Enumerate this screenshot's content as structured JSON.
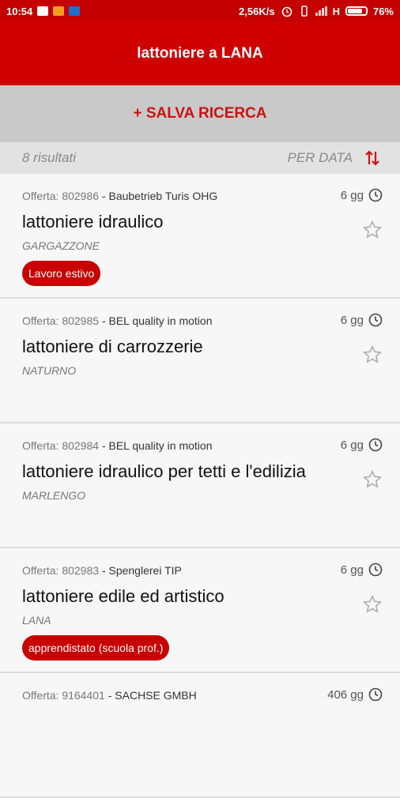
{
  "status": {
    "time": "10:54",
    "speed": "2,56K/s",
    "network": "H",
    "battery": "76%"
  },
  "header": {
    "title": "lattoniere a LANA"
  },
  "save": {
    "label": "+ SALVA RICERCA"
  },
  "sort": {
    "count": "8 risultati",
    "label": "PER DATA",
    "icon": "sort-arrows-icon"
  },
  "offer_prefix": "Offerta:",
  "colors": {
    "primary": "#cf0000",
    "save_text": "#cc1111",
    "tag_bg": "#c80000"
  },
  "jobs": [
    {
      "id": "802986",
      "company": "- Baubetrieb Turis OHG",
      "age": "6 gg",
      "title": "lattoniere idraulico",
      "place": "GARGAZZONE",
      "tag": "Lavoro estivo"
    },
    {
      "id": "802985",
      "company": "- BEL quality in motion",
      "age": "6 gg",
      "title": "lattoniere di carrozzerie",
      "place": "NATURNO",
      "tag": ""
    },
    {
      "id": "802984",
      "company": "- BEL quality in motion",
      "age": "6 gg",
      "title": "lattoniere idraulico per tetti e l'edilizia",
      "place": "MARLENGO",
      "tag": ""
    },
    {
      "id": "802983",
      "company": "- Spenglerei TIP",
      "age": "6 gg",
      "title": "lattoniere edile ed artistico",
      "place": "LANA",
      "tag": "apprendistato (scuola prof.)"
    },
    {
      "id": "9164401",
      "company": "- SACHSE GMBH",
      "age": "406 gg",
      "title": "",
      "place": "",
      "tag": ""
    }
  ]
}
